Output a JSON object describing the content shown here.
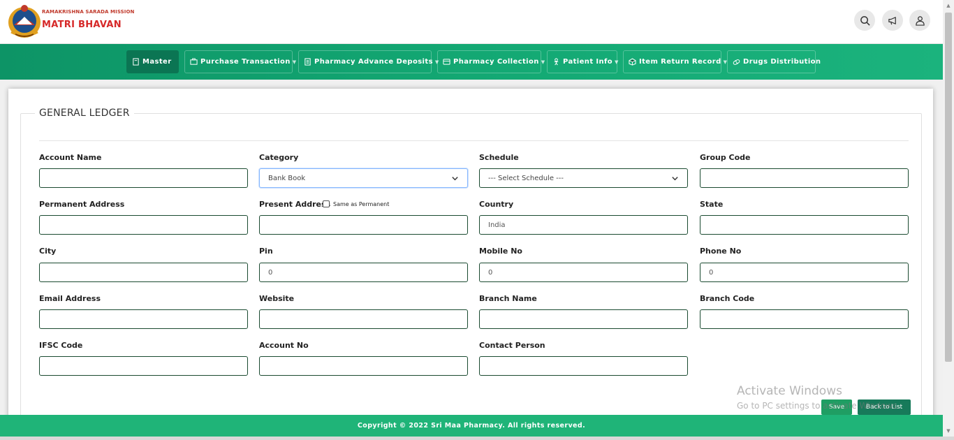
{
  "header": {
    "brand_small": "RAMAKRISHNA SARADA MISSION",
    "brand_big": "MATRI BHAVAN"
  },
  "nav": {
    "items": [
      {
        "label": "Master",
        "icon": "book-icon",
        "active": true,
        "dropdown": false
      },
      {
        "label": "Purchase Transaction",
        "icon": "briefcase-icon",
        "active": false,
        "dropdown": true
      },
      {
        "label": "Pharmacy Advance Deposits",
        "icon": "document-icon",
        "active": false,
        "dropdown": true
      },
      {
        "label": "Pharmacy Collection",
        "icon": "wallet-icon",
        "active": false,
        "dropdown": true
      },
      {
        "label": "Patient Info",
        "icon": "person-icon",
        "active": false,
        "dropdown": true
      },
      {
        "label": "Item Return Record",
        "icon": "box-icon",
        "active": false,
        "dropdown": true
      },
      {
        "label": "Drugs Distribution",
        "icon": "pills-icon",
        "active": false,
        "dropdown": false
      }
    ]
  },
  "form": {
    "title": "GENERAL LEDGER",
    "account_name": {
      "label": "Account Name",
      "value": ""
    },
    "category": {
      "label": "Category",
      "value": "Bank Book"
    },
    "schedule": {
      "label": "Schedule",
      "value": "--- Select Schedule ---"
    },
    "group_code": {
      "label": "Group Code",
      "value": ""
    },
    "permanent_address": {
      "label": "Permanent Address",
      "value": ""
    },
    "present_address": {
      "label": "Present Address",
      "value": "",
      "same_as_label": "Same as Permanent",
      "same_as_checked": false
    },
    "country": {
      "label": "Country",
      "value": "India"
    },
    "state": {
      "label": "State",
      "value": ""
    },
    "city": {
      "label": "City",
      "value": ""
    },
    "pin": {
      "label": "Pin",
      "value": "0"
    },
    "mobile_no": {
      "label": "Mobile No",
      "value": "0"
    },
    "phone_no": {
      "label": "Phone No",
      "value": "0"
    },
    "email": {
      "label": "Email Address",
      "value": ""
    },
    "website": {
      "label": "Website",
      "value": ""
    },
    "branch_name": {
      "label": "Branch Name",
      "value": ""
    },
    "branch_code": {
      "label": "Branch Code",
      "value": ""
    },
    "ifsc_code": {
      "label": "IFSC Code",
      "value": ""
    },
    "account_no": {
      "label": "Account No",
      "value": ""
    },
    "contact_person": {
      "label": "Contact Person",
      "value": ""
    },
    "save_label": "Save",
    "back_label": "Back to List"
  },
  "watermark": {
    "line1": "Activate Windows",
    "line2": "Go to PC settings to activate Windows."
  },
  "footer": {
    "text": "Copyright © 2022 Sri Maa Pharmacy. All rights reserved."
  },
  "colors": {
    "nav_green": "#13a873",
    "nav_active": "#0b7553",
    "footer_green": "#1fb478",
    "brand_red": "#d62828"
  }
}
